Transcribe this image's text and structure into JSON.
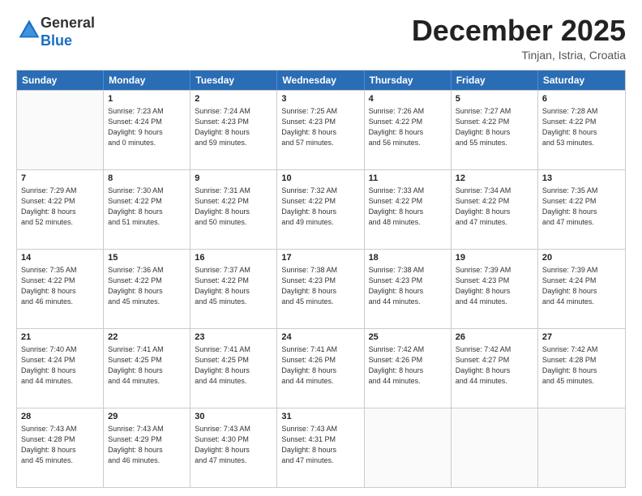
{
  "header": {
    "logo_general": "General",
    "logo_blue": "Blue",
    "month_title": "December 2025",
    "location": "Tinjan, Istria, Croatia"
  },
  "days_of_week": [
    "Sunday",
    "Monday",
    "Tuesday",
    "Wednesday",
    "Thursday",
    "Friday",
    "Saturday"
  ],
  "weeks": [
    [
      {
        "day": "",
        "lines": []
      },
      {
        "day": "1",
        "lines": [
          "Sunrise: 7:23 AM",
          "Sunset: 4:24 PM",
          "Daylight: 9 hours",
          "and 0 minutes."
        ]
      },
      {
        "day": "2",
        "lines": [
          "Sunrise: 7:24 AM",
          "Sunset: 4:23 PM",
          "Daylight: 8 hours",
          "and 59 minutes."
        ]
      },
      {
        "day": "3",
        "lines": [
          "Sunrise: 7:25 AM",
          "Sunset: 4:23 PM",
          "Daylight: 8 hours",
          "and 57 minutes."
        ]
      },
      {
        "day": "4",
        "lines": [
          "Sunrise: 7:26 AM",
          "Sunset: 4:22 PM",
          "Daylight: 8 hours",
          "and 56 minutes."
        ]
      },
      {
        "day": "5",
        "lines": [
          "Sunrise: 7:27 AM",
          "Sunset: 4:22 PM",
          "Daylight: 8 hours",
          "and 55 minutes."
        ]
      },
      {
        "day": "6",
        "lines": [
          "Sunrise: 7:28 AM",
          "Sunset: 4:22 PM",
          "Daylight: 8 hours",
          "and 53 minutes."
        ]
      }
    ],
    [
      {
        "day": "7",
        "lines": [
          "Sunrise: 7:29 AM",
          "Sunset: 4:22 PM",
          "Daylight: 8 hours",
          "and 52 minutes."
        ]
      },
      {
        "day": "8",
        "lines": [
          "Sunrise: 7:30 AM",
          "Sunset: 4:22 PM",
          "Daylight: 8 hours",
          "and 51 minutes."
        ]
      },
      {
        "day": "9",
        "lines": [
          "Sunrise: 7:31 AM",
          "Sunset: 4:22 PM",
          "Daylight: 8 hours",
          "and 50 minutes."
        ]
      },
      {
        "day": "10",
        "lines": [
          "Sunrise: 7:32 AM",
          "Sunset: 4:22 PM",
          "Daylight: 8 hours",
          "and 49 minutes."
        ]
      },
      {
        "day": "11",
        "lines": [
          "Sunrise: 7:33 AM",
          "Sunset: 4:22 PM",
          "Daylight: 8 hours",
          "and 48 minutes."
        ]
      },
      {
        "day": "12",
        "lines": [
          "Sunrise: 7:34 AM",
          "Sunset: 4:22 PM",
          "Daylight: 8 hours",
          "and 47 minutes."
        ]
      },
      {
        "day": "13",
        "lines": [
          "Sunrise: 7:35 AM",
          "Sunset: 4:22 PM",
          "Daylight: 8 hours",
          "and 47 minutes."
        ]
      }
    ],
    [
      {
        "day": "14",
        "lines": [
          "Sunrise: 7:35 AM",
          "Sunset: 4:22 PM",
          "Daylight: 8 hours",
          "and 46 minutes."
        ]
      },
      {
        "day": "15",
        "lines": [
          "Sunrise: 7:36 AM",
          "Sunset: 4:22 PM",
          "Daylight: 8 hours",
          "and 45 minutes."
        ]
      },
      {
        "day": "16",
        "lines": [
          "Sunrise: 7:37 AM",
          "Sunset: 4:22 PM",
          "Daylight: 8 hours",
          "and 45 minutes."
        ]
      },
      {
        "day": "17",
        "lines": [
          "Sunrise: 7:38 AM",
          "Sunset: 4:23 PM",
          "Daylight: 8 hours",
          "and 45 minutes."
        ]
      },
      {
        "day": "18",
        "lines": [
          "Sunrise: 7:38 AM",
          "Sunset: 4:23 PM",
          "Daylight: 8 hours",
          "and 44 minutes."
        ]
      },
      {
        "day": "19",
        "lines": [
          "Sunrise: 7:39 AM",
          "Sunset: 4:23 PM",
          "Daylight: 8 hours",
          "and 44 minutes."
        ]
      },
      {
        "day": "20",
        "lines": [
          "Sunrise: 7:39 AM",
          "Sunset: 4:24 PM",
          "Daylight: 8 hours",
          "and 44 minutes."
        ]
      }
    ],
    [
      {
        "day": "21",
        "lines": [
          "Sunrise: 7:40 AM",
          "Sunset: 4:24 PM",
          "Daylight: 8 hours",
          "and 44 minutes."
        ]
      },
      {
        "day": "22",
        "lines": [
          "Sunrise: 7:41 AM",
          "Sunset: 4:25 PM",
          "Daylight: 8 hours",
          "and 44 minutes."
        ]
      },
      {
        "day": "23",
        "lines": [
          "Sunrise: 7:41 AM",
          "Sunset: 4:25 PM",
          "Daylight: 8 hours",
          "and 44 minutes."
        ]
      },
      {
        "day": "24",
        "lines": [
          "Sunrise: 7:41 AM",
          "Sunset: 4:26 PM",
          "Daylight: 8 hours",
          "and 44 minutes."
        ]
      },
      {
        "day": "25",
        "lines": [
          "Sunrise: 7:42 AM",
          "Sunset: 4:26 PM",
          "Daylight: 8 hours",
          "and 44 minutes."
        ]
      },
      {
        "day": "26",
        "lines": [
          "Sunrise: 7:42 AM",
          "Sunset: 4:27 PM",
          "Daylight: 8 hours",
          "and 44 minutes."
        ]
      },
      {
        "day": "27",
        "lines": [
          "Sunrise: 7:42 AM",
          "Sunset: 4:28 PM",
          "Daylight: 8 hours",
          "and 45 minutes."
        ]
      }
    ],
    [
      {
        "day": "28",
        "lines": [
          "Sunrise: 7:43 AM",
          "Sunset: 4:28 PM",
          "Daylight: 8 hours",
          "and 45 minutes."
        ]
      },
      {
        "day": "29",
        "lines": [
          "Sunrise: 7:43 AM",
          "Sunset: 4:29 PM",
          "Daylight: 8 hours",
          "and 46 minutes."
        ]
      },
      {
        "day": "30",
        "lines": [
          "Sunrise: 7:43 AM",
          "Sunset: 4:30 PM",
          "Daylight: 8 hours",
          "and 47 minutes."
        ]
      },
      {
        "day": "31",
        "lines": [
          "Sunrise: 7:43 AM",
          "Sunset: 4:31 PM",
          "Daylight: 8 hours",
          "and 47 minutes."
        ]
      },
      {
        "day": "",
        "lines": []
      },
      {
        "day": "",
        "lines": []
      },
      {
        "day": "",
        "lines": []
      }
    ]
  ]
}
